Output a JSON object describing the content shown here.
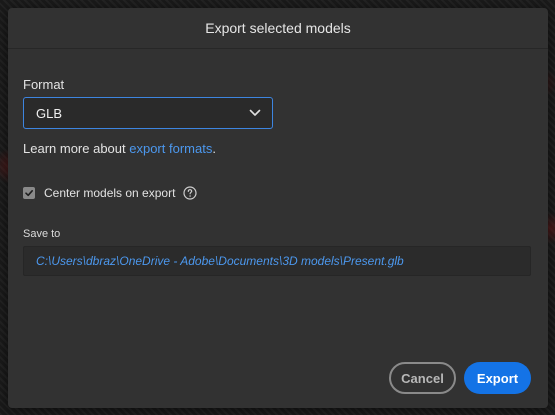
{
  "dialog": {
    "title": "Export selected models"
  },
  "format": {
    "label": "Format",
    "selected": "GLB"
  },
  "learn_more": {
    "prefix": "Learn more about ",
    "link_text": "export formats",
    "suffix": "."
  },
  "center_models": {
    "label": "Center models on export",
    "checked": true
  },
  "save_to": {
    "label": "Save to",
    "path": "C:\\Users\\dbraz\\OneDrive - Adobe\\Documents\\3D models\\Present.glb"
  },
  "buttons": {
    "cancel": "Cancel",
    "export": "Export"
  },
  "colors": {
    "accent": "#1473e6",
    "link": "#4c98ee",
    "dialog_bg": "#323232"
  },
  "icons": {
    "dropdown": "chevron-down-icon",
    "help": "help-circle-icon",
    "check": "checkmark-icon"
  }
}
